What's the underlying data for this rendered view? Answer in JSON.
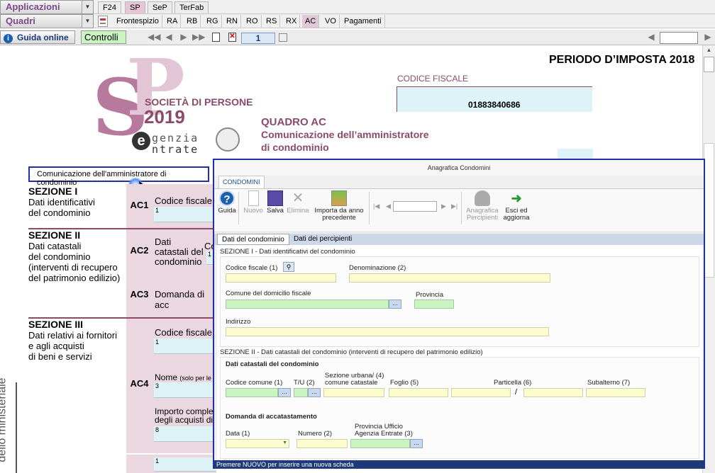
{
  "menubar": {
    "applicazioni": "Applicazioni",
    "quadri": "Quadri"
  },
  "app_tabs": [
    "F24",
    "SP",
    "SeP",
    "TerFab"
  ],
  "quadri_tabs": [
    "Frontespizio",
    "RA",
    "RB",
    "RG",
    "RN",
    "RO",
    "RS",
    "RX",
    "AC",
    "VO",
    "Pagamenti"
  ],
  "toolbar": {
    "help": "Guida online",
    "controls": "Controlli",
    "page": "1"
  },
  "header": {
    "period": "PERIODO D’IMPOSTA 2018",
    "cf_label": "CODICE FISCALE",
    "cf_value": "01883840686",
    "logo_line1": "SOCIETÀ DI PERSONE",
    "logo_year": "2019",
    "logo_agenzia": "genzia",
    "logo_entrate": "ntrate",
    "quadro_code": "QUADRO AC",
    "quadro_l1": "Comunicazione dell’amministratore",
    "quadro_l2": "di condominio"
  },
  "doc": {
    "sticky_button": "Comunicazione dell'amministratore di condominio",
    "side_text": "dello ministeriale",
    "sec1": {
      "title": "SEZIONE I",
      "l1": "Dati identificativi",
      "l2": "del condominio"
    },
    "sec2": {
      "title": "SEZIONE II",
      "l1": "Dati catastali",
      "l2": "del condominio",
      "l3": "(interventi di recupero",
      "l4": "del patrimonio edilizio)"
    },
    "sec3": {
      "title": "SEZIONE III",
      "l1": "Dati relativi ai fornitori",
      "l2": "e agli acquisti",
      "l3": "di beni e servizi"
    },
    "ac1": "AC1",
    "ac2": "AC2",
    "ac3": "AC3",
    "ac4": "AC4",
    "f_ac1": "Codice fiscale",
    "f_ac1_n": "1",
    "f_ac2_l1": "Dati",
    "f_ac2_l2": "catastali del",
    "f_ac2_l3": "condominio",
    "f_ac2_c": "Co",
    "f_ac2_n": "1",
    "f_ac3": "Domanda di acc",
    "f_ac4_cf": "Codice fiscale",
    "f_ac4_cf_n": "1",
    "f_ac4_nome": "Nome",
    "f_ac4_nome_small": "(solo per le",
    "f_ac4_nome_n": "3",
    "f_ac4_imp1": "Importo comples",
    "f_ac4_imp2": "degli acquisti di",
    "f_ac4_imp_n": "8",
    "f_bottom_n": "1"
  },
  "dialog": {
    "title": "Anagrafica Condomini",
    "ribbon_tab": "CONDOMINI",
    "btn_guida": "Guida",
    "btn_nuovo": "Nuovo",
    "btn_salva": "Salva",
    "btn_elimina": "Elimina",
    "btn_importa1": "Importa da anno",
    "btn_importa2": "precedente",
    "btn_anag1": "Anagrafica",
    "btn_anag2": "Percipienti",
    "btn_esci1": "Esci ed",
    "btn_esci2": "aggiorna",
    "subtab1": "Dati del condominio",
    "subtab2": "Dati dei percipienti",
    "s1_title": "SEZIONE I - Dati identificativi del condominio",
    "cf": "Codice fiscale",
    "cf_n": "(1)",
    "denom": "Denominazione",
    "denom_n": "(2)",
    "comune": "Comune del domicilio fiscale",
    "provincia": "Provincia",
    "indirizzo": "Indirizzo",
    "s2_title": "SEZIONE II - Dati catastali del condominio (interventi di recupero del patrimonio edilizio)",
    "catastali": "Dati catastali del condominio",
    "cod_comune": "Codice comune",
    "cod_comune_n": "(1)",
    "tu": "T/U",
    "tu_n": "(2)",
    "sez1": "Sezione urbana/",
    "sez2": "comune catastale",
    "sez_n": "(4)",
    "foglio": "Foglio",
    "foglio_n": "(5)",
    "particella": "Particella",
    "particella_n": "(6)",
    "subalterno": "Subalterno",
    "subalterno_n": "(7)",
    "domanda": "Domanda di accatastamento",
    "data": "Data",
    "data_n": "(1)",
    "numero": "Numero",
    "numero_n": "(2)",
    "prov1": "Provincia Ufficio",
    "prov2": "Agenzia Entrate",
    "prov_n": "(3)",
    "status": "Premere NUOVO per inserire una nuova scheda"
  },
  "colors": {
    "plum": "#c08aa6",
    "dialog_border": "#2230a8",
    "status_bg": "#1e3a78",
    "field_yellow": "#fdfbd0",
    "field_green": "#c8f5c0"
  }
}
